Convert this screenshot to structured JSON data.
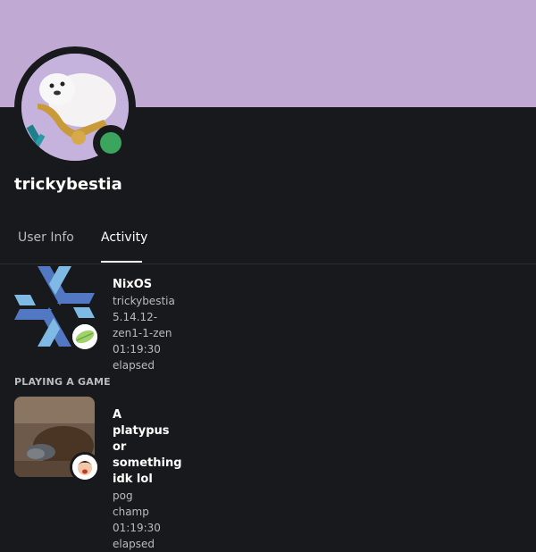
{
  "profile": {
    "username": "trickybestia",
    "status_color": "#3ba55d",
    "banner_color": "#c0aad4"
  },
  "tabs": [
    {
      "label": "User Info",
      "active": false
    },
    {
      "label": "Activity",
      "active": true
    }
  ],
  "activities": [
    {
      "name": "NixOS",
      "lines": [
        "trickybestia",
        "5.14.12-zen1-1-zen",
        "01:19:30 elapsed"
      ],
      "large_image": "nixos-logo-icon",
      "small_image": "leaf-icon"
    }
  ],
  "playing_section": {
    "header": "PLAYING A GAME",
    "game": {
      "name": "A platypus or something idk lol",
      "lines": [
        "pog",
        "champ",
        "01:19:30 elapsed"
      ],
      "large_image": "platypus-photo",
      "small_image": "face-avatar-icon"
    }
  }
}
